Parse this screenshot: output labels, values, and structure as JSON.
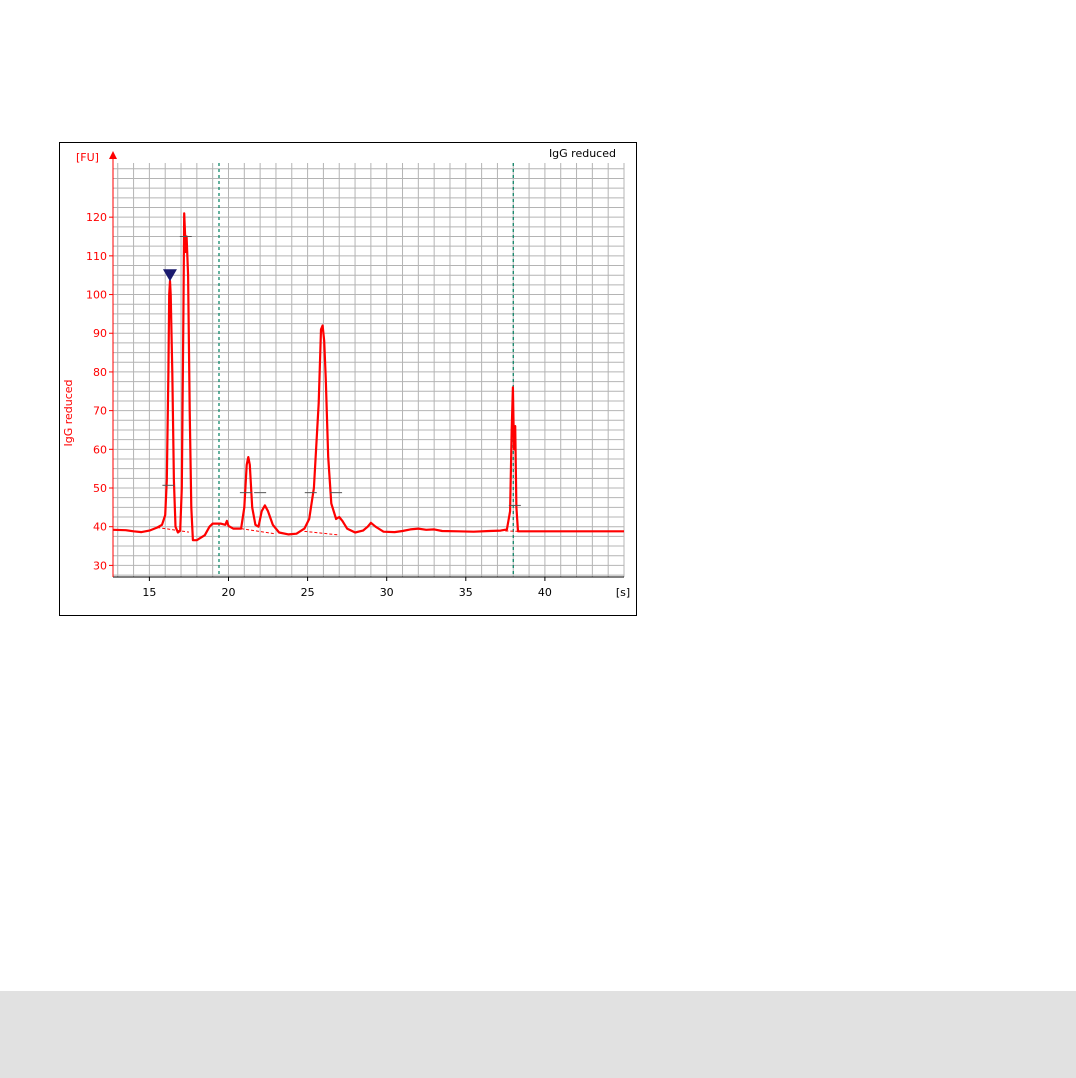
{
  "chart_data": {
    "type": "line",
    "title": "IgG reduced",
    "ylabel": "IgG reduced",
    "y_unit": "[FU]",
    "x_unit": "[s]",
    "xlim": [
      12.7,
      45
    ],
    "ylim": [
      27,
      134
    ],
    "x_ticks": [
      15,
      20,
      25,
      30,
      35,
      40
    ],
    "y_ticks": [
      30,
      40,
      50,
      60,
      70,
      80,
      90,
      100,
      110,
      120
    ],
    "grid": true,
    "dashed_markers_x": [
      19.4,
      38.0
    ],
    "peak_marker": {
      "x": 16.3,
      "y": 105
    },
    "colors": {
      "trace": "#ff0000",
      "axis_text": "#ff0000",
      "grid": "#b4b4b4",
      "marker_lines": "#008060",
      "peak_marker": "#1a1a6e",
      "baseline_marks": "#555555"
    },
    "series": [
      {
        "values": [
          [
            12.7,
            39.2
          ],
          [
            13.5,
            39.1
          ],
          [
            14.0,
            38.8
          ],
          [
            14.5,
            38.6
          ],
          [
            15.0,
            39.0
          ],
          [
            15.5,
            39.8
          ],
          [
            15.8,
            40.5
          ],
          [
            16.0,
            43
          ],
          [
            16.1,
            52
          ],
          [
            16.2,
            80
          ],
          [
            16.25,
            100
          ],
          [
            16.3,
            103.5
          ],
          [
            16.35,
            100
          ],
          [
            16.45,
            80
          ],
          [
            16.55,
            52
          ],
          [
            16.65,
            40
          ],
          [
            16.8,
            38.5
          ],
          [
            16.95,
            39
          ],
          [
            17.05,
            50
          ],
          [
            17.15,
            95
          ],
          [
            17.2,
            121
          ],
          [
            17.3,
            111
          ],
          [
            17.35,
            115
          ],
          [
            17.45,
            105
          ],
          [
            17.55,
            70
          ],
          [
            17.65,
            45
          ],
          [
            17.75,
            36.5
          ],
          [
            18.0,
            36.5
          ],
          [
            18.5,
            37.8
          ],
          [
            18.8,
            40
          ],
          [
            19.0,
            40.8
          ],
          [
            19.5,
            40.8
          ],
          [
            19.8,
            40.5
          ],
          [
            19.9,
            41.5
          ],
          [
            20.0,
            40.2
          ],
          [
            20.3,
            39.5
          ],
          [
            20.8,
            39.5
          ],
          [
            21.0,
            45
          ],
          [
            21.15,
            56
          ],
          [
            21.25,
            58
          ],
          [
            21.35,
            56
          ],
          [
            21.5,
            45
          ],
          [
            21.7,
            40.5
          ],
          [
            21.9,
            40
          ],
          [
            22.1,
            44
          ],
          [
            22.3,
            45.5
          ],
          [
            22.5,
            44
          ],
          [
            22.8,
            40.5
          ],
          [
            23.2,
            38.5
          ],
          [
            23.8,
            38
          ],
          [
            24.3,
            38.2
          ],
          [
            24.8,
            39.5
          ],
          [
            25.1,
            42
          ],
          [
            25.4,
            50
          ],
          [
            25.7,
            72
          ],
          [
            25.85,
            91
          ],
          [
            25.95,
            92
          ],
          [
            26.05,
            88
          ],
          [
            26.15,
            78
          ],
          [
            26.3,
            58
          ],
          [
            26.5,
            46
          ],
          [
            26.8,
            42
          ],
          [
            27.0,
            42.5
          ],
          [
            27.2,
            41.5
          ],
          [
            27.5,
            39.5
          ],
          [
            28.0,
            38.5
          ],
          [
            28.5,
            39
          ],
          [
            28.8,
            40
          ],
          [
            29.0,
            41
          ],
          [
            29.3,
            40
          ],
          [
            29.8,
            38.7
          ],
          [
            30.5,
            38.6
          ],
          [
            31.0,
            38.9
          ],
          [
            31.5,
            39.3
          ],
          [
            32.0,
            39.5
          ],
          [
            32.5,
            39.2
          ],
          [
            33.0,
            39.3
          ],
          [
            33.5,
            38.9
          ],
          [
            34.5,
            38.8
          ],
          [
            35.5,
            38.7
          ],
          [
            36.5,
            38.9
          ],
          [
            37.2,
            39
          ],
          [
            37.6,
            39.3
          ],
          [
            37.8,
            44
          ],
          [
            37.9,
            65
          ],
          [
            37.98,
            76
          ],
          [
            38.05,
            60
          ],
          [
            38.12,
            66
          ],
          [
            38.2,
            45
          ],
          [
            38.3,
            38.8
          ],
          [
            38.5,
            38.8
          ],
          [
            40.0,
            38.8
          ],
          [
            42.0,
            38.8
          ],
          [
            45.0,
            38.8
          ]
        ]
      }
    ],
    "baseline_dashes": [
      [
        [
          15.5,
          39.8
        ],
        [
          17.5,
          38.6
        ]
      ],
      [
        [
          20.8,
          39.5
        ],
        [
          22.9,
          38.2
        ]
      ],
      [
        [
          24.8,
          38.8
        ],
        [
          26.9,
          37.9
        ]
      ],
      [
        [
          37.5,
          38.9
        ],
        [
          38.4,
          38.8
        ]
      ]
    ],
    "peak_level_marks": [
      [
        16.2,
        50.7
      ],
      [
        17.3,
        115
      ],
      [
        21.1,
        48.8
      ],
      [
        22.0,
        48.8
      ],
      [
        25.2,
        48.8
      ],
      [
        26.8,
        48.8
      ],
      [
        38.1,
        45.5
      ]
    ]
  }
}
